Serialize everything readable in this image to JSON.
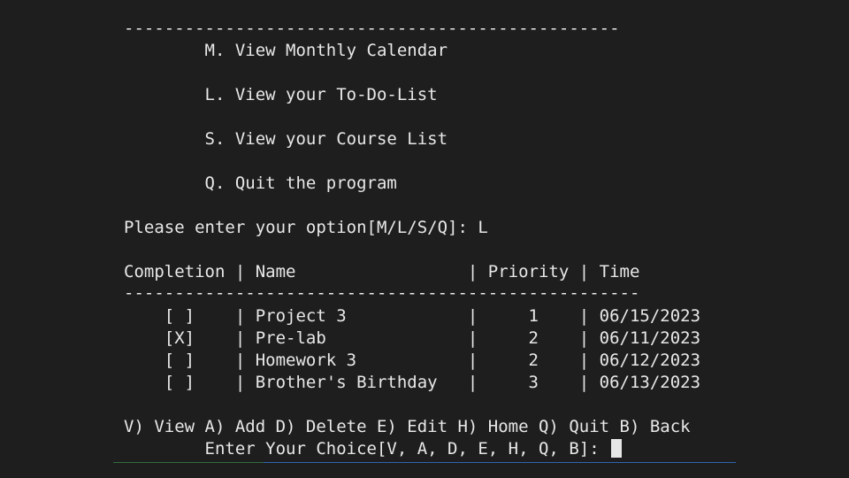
{
  "menu": {
    "top_rule": "-------------------------------------------------",
    "items": [
      "        M. View Monthly Calendar",
      "        L. View your To-Do-List",
      "        S. View your Course List",
      "        Q. Quit the program"
    ],
    "prompt": "Please enter your option[M/L/S/Q]: L"
  },
  "todo": {
    "header": "Completion | Name                 | Priority | Time",
    "rule": "---------------------------------------------------",
    "rows": [
      "    [ ]    | Project 3            |     1    | 06/15/2023",
      "    [X]    | Pre-lab              |     2    | 06/11/2023",
      "    [ ]    | Homework 3           |     2    | 06/12/2023",
      "    [ ]    | Brother's Birthday   |     3    | 06/13/2023"
    ]
  },
  "actions": {
    "options": "V) View A) Add D) Delete E) Edit H) Home Q) Quit B) Back",
    "prompt": "        Enter Your Choice[V, A, D, E, H, Q, B]: "
  }
}
